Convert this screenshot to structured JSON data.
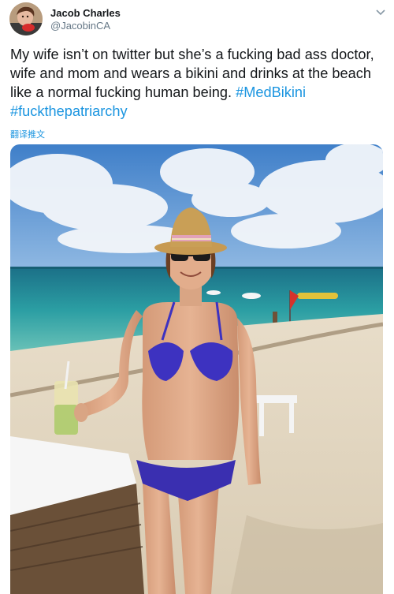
{
  "author": {
    "name": "Jacob Charles",
    "handle": "@JacobinCA",
    "avatar_icon": "profile-avatar"
  },
  "tweet": {
    "text_plain": "My wife isn’t on twitter but she’s a fucking bad ass doctor, wife and mom and wears a bikini and drinks at the beach like a normal fucking human being. ",
    "hashtags": [
      "#MedBikini",
      "#fuckthepatriarchy"
    ],
    "translate_label": "翻译推文"
  },
  "media": {
    "description_icon": "beach-photo"
  },
  "menu": {
    "icon": "chevron-down-icon"
  },
  "colors": {
    "link": "#1b95e0",
    "text": "#14171a",
    "secondary": "#657786"
  }
}
